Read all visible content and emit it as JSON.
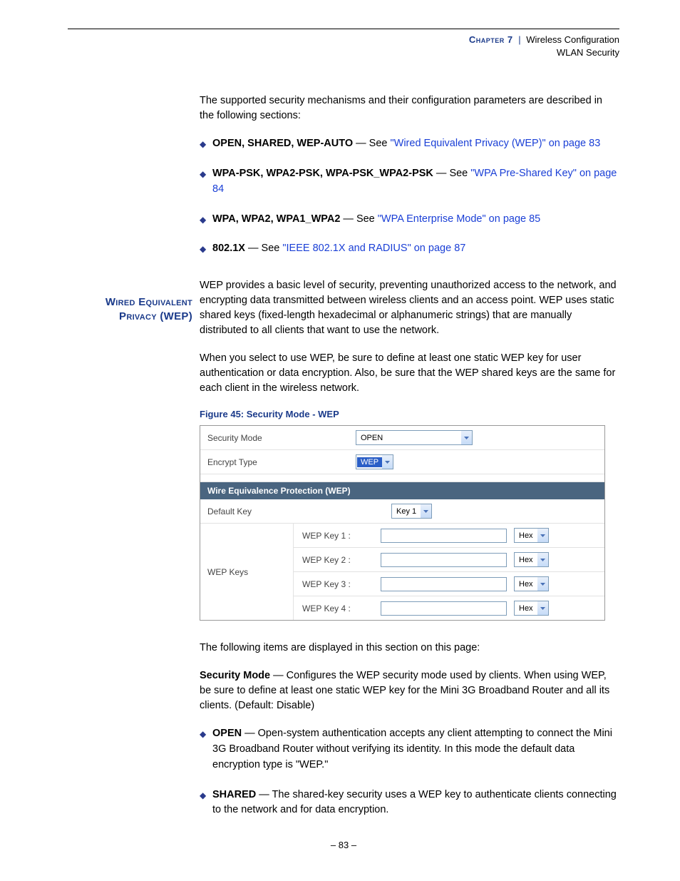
{
  "header": {
    "chapter": "Chapter 7",
    "title": "Wireless Configuration",
    "subtitle": "WLAN Security"
  },
  "intro": "The supported security mechanisms and their configuration parameters are described in the following sections:",
  "bullets": [
    {
      "bold": "OPEN, SHARED, WEP-AUTO",
      "mid": " — See ",
      "link": "\"Wired Equivalent Privacy (WEP)\" on page 83"
    },
    {
      "bold": "WPA-PSK, WPA2-PSK, WPA-PSK_WPA2-PSK",
      "mid": " — See ",
      "link": "\"WPA Pre-Shared Key\" on page 84"
    },
    {
      "bold": "WPA, WPA2, WPA1_WPA2",
      "mid": " — See ",
      "link": "\"WPA Enterprise Mode\" on page 85"
    },
    {
      "bold": "802.1X",
      "mid": " — See ",
      "link": "\"IEEE 802.1X and RADIUS\" on page 87"
    }
  ],
  "margin_title": "Wired Equivalent Privacy (WEP)",
  "wep_para1": "WEP provides a basic level of security, preventing unauthorized access to the network, and encrypting data transmitted between wireless clients and an access point. WEP uses static shared keys (fixed-length hexadecimal or alphanumeric strings) that are manually distributed to all clients that want to use the network.",
  "wep_para2": "When you select to use WEP, be sure to define at least one static WEP key for user authentication or data encryption. Also, be sure that the WEP shared keys are the same for each client in the wireless network.",
  "figure_caption": "Figure 45:  Security Mode - WEP",
  "ui": {
    "security_mode_label": "Security Mode",
    "security_mode_value": "OPEN",
    "encrypt_type_label": "Encrypt Type",
    "encrypt_type_value": "WEP",
    "section_title": "Wire Equivalence Protection (WEP)",
    "default_key_label": "Default Key",
    "default_key_value": "Key 1",
    "wep_keys_label": "WEP Keys",
    "keys": [
      {
        "label": "WEP Key 1 :",
        "type": "Hex"
      },
      {
        "label": "WEP Key 2 :",
        "type": "Hex"
      },
      {
        "label": "WEP Key 3 :",
        "type": "Hex"
      },
      {
        "label": "WEP Key 4 :",
        "type": "Hex"
      }
    ]
  },
  "post1": "The following items are displayed in this section on this page:",
  "post2_bold": "Security Mode",
  "post2_text": " — Configures the WEP security mode used by clients. When using WEP, be sure to define at least one static WEP key for the Mini 3G Broadband Router and all its clients. (Default: Disable)",
  "bullets2": [
    {
      "bold": "OPEN",
      "text": " — Open-system authentication accepts any client attempting to connect the Mini 3G Broadband Router without verifying its identity. In this mode the default data encryption type is \"WEP.\""
    },
    {
      "bold": "SHARED",
      "text": " — The shared-key security uses a WEP key to authenticate clients connecting to the network and for data encryption."
    }
  ],
  "page_number": "–  83  –"
}
